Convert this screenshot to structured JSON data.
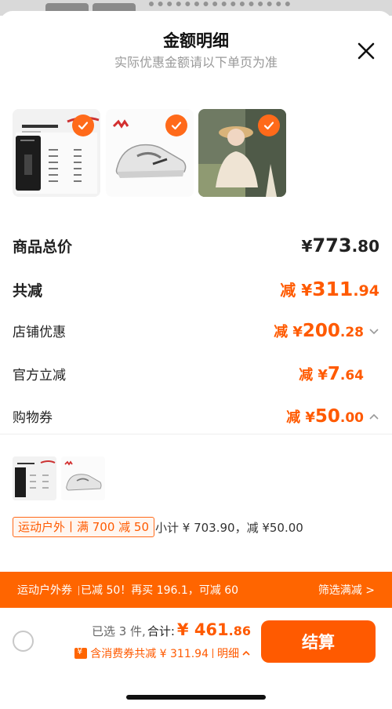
{
  "header": {
    "title": "金额明细",
    "subtitle": "实际优惠金额请以下单页为准"
  },
  "products": [
    {
      "name": "产品参数",
      "sub": "PRODUCT",
      "checked": true
    },
    {
      "name": "sneaker",
      "checked": true
    },
    {
      "name": "apparel",
      "checked": true
    }
  ],
  "summary": {
    "total_label": "商品总价",
    "total_prefix": "¥",
    "total_int": "773",
    "total_dec": ".80",
    "reduce_label": "共减",
    "reduce_prefix": "减 ¥",
    "reduce_int": "311",
    "reduce_dec": ".94",
    "shop_label": "店铺优惠",
    "shop_prefix": "减 ¥",
    "shop_int": "200",
    "shop_dec": ".28",
    "official_label": "官方立减",
    "official_prefix": "减 ¥",
    "official_int": "7",
    "official_dec": ".64",
    "coupon_label": "购物券",
    "coupon_prefix": "减 ¥",
    "coupon_int": "50",
    "coupon_dec": ".00"
  },
  "coupon_detail": {
    "tag": "运动户外丨满 700 减 50",
    "subtotal": "小计 ¥ 703.90，减 ¥50.00"
  },
  "banner": {
    "name": "运动户外券",
    "text": "已减 50！再买 196.1，可减 60",
    "action": "筛选满减 >"
  },
  "footer": {
    "selected": "已选 3 件,",
    "total_label": "合计:",
    "total_prefix": "¥",
    "total_int": "461",
    "total_dec": ".86",
    "discount_text": "含消费券共减 ¥ 311.94",
    "detail_link": "明细",
    "checkout": "结算"
  },
  "colors": {
    "accent": "#ff5a00",
    "banner": "#ff6500"
  }
}
